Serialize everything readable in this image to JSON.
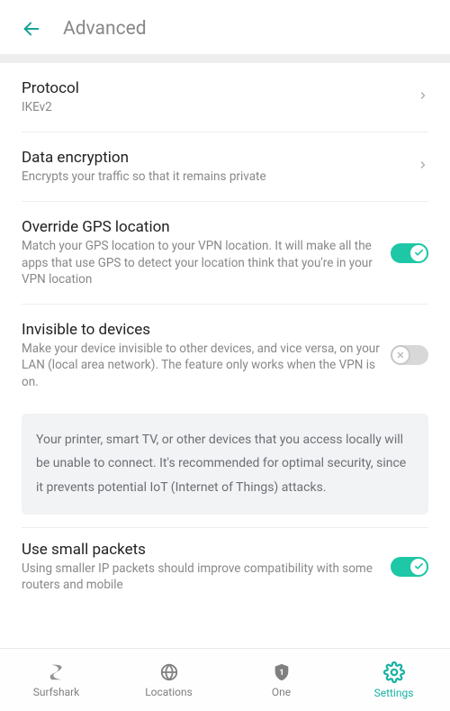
{
  "header": {
    "title": "Advanced"
  },
  "rows": {
    "protocol": {
      "title": "Protocol",
      "value": "IKEv2"
    },
    "encryption": {
      "title": "Data encryption",
      "sub": "Encrypts your traffic so that it remains private"
    },
    "gps": {
      "title": "Override GPS location",
      "sub": "Match your GPS location to your VPN location. It will make all the apps that use GPS to detect your location think that you're in your VPN location",
      "enabled": true
    },
    "invisible": {
      "title": "Invisible to devices",
      "sub": "Make your device invisible to other devices, and vice versa, on your LAN (local area network). The feature only works when the VPN is on.",
      "enabled": false,
      "info": "Your printer, smart TV, or other devices that you access locally will be unable to connect. It's recommended for optimal security, since it prevents potential IoT (Internet of Things) attacks."
    },
    "small_packets": {
      "title": "Use small packets",
      "sub": "Using smaller IP packets should improve compatibility with some routers and mobile",
      "enabled": true
    }
  },
  "nav": {
    "surfshark": "Surfshark",
    "locations": "Locations",
    "one": "One",
    "settings": "Settings"
  }
}
